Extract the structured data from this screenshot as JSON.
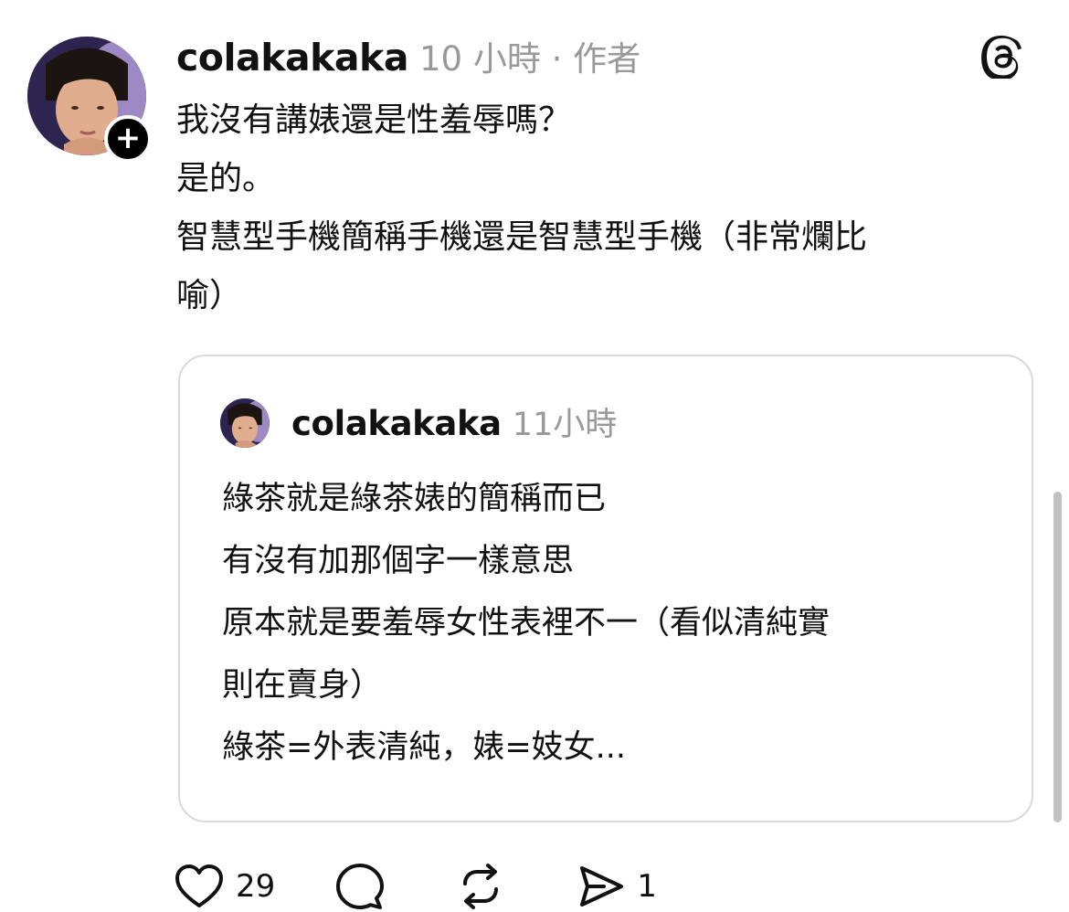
{
  "post": {
    "username": "colakakaka",
    "meta": "10 小時 · 作者",
    "lines": [
      "我沒有講婊還是性羞辱嗎？",
      "是的。",
      "智慧型手機簡稱手機還是智慧型手機（非常爛比",
      "喻）"
    ]
  },
  "quote": {
    "username": "colakakaka",
    "time": "11小時",
    "lines": [
      "綠茶就是綠茶婊的簡稱而已",
      "有沒有加那個字一樣意思",
      "原本就是要羞辱女性表裡不一（看似清純實",
      "則在賣身）",
      "綠茶=外表清純，婊=妓女..."
    ]
  },
  "actions": {
    "like_count": "29",
    "comment_count": "",
    "repost_count": "",
    "share_count": "1"
  },
  "icons": {
    "follow": "plus-icon",
    "app": "threads-logo-icon",
    "like": "heart-icon",
    "comment": "speech-bubble-icon",
    "repost": "repost-icon",
    "share": "send-icon"
  }
}
